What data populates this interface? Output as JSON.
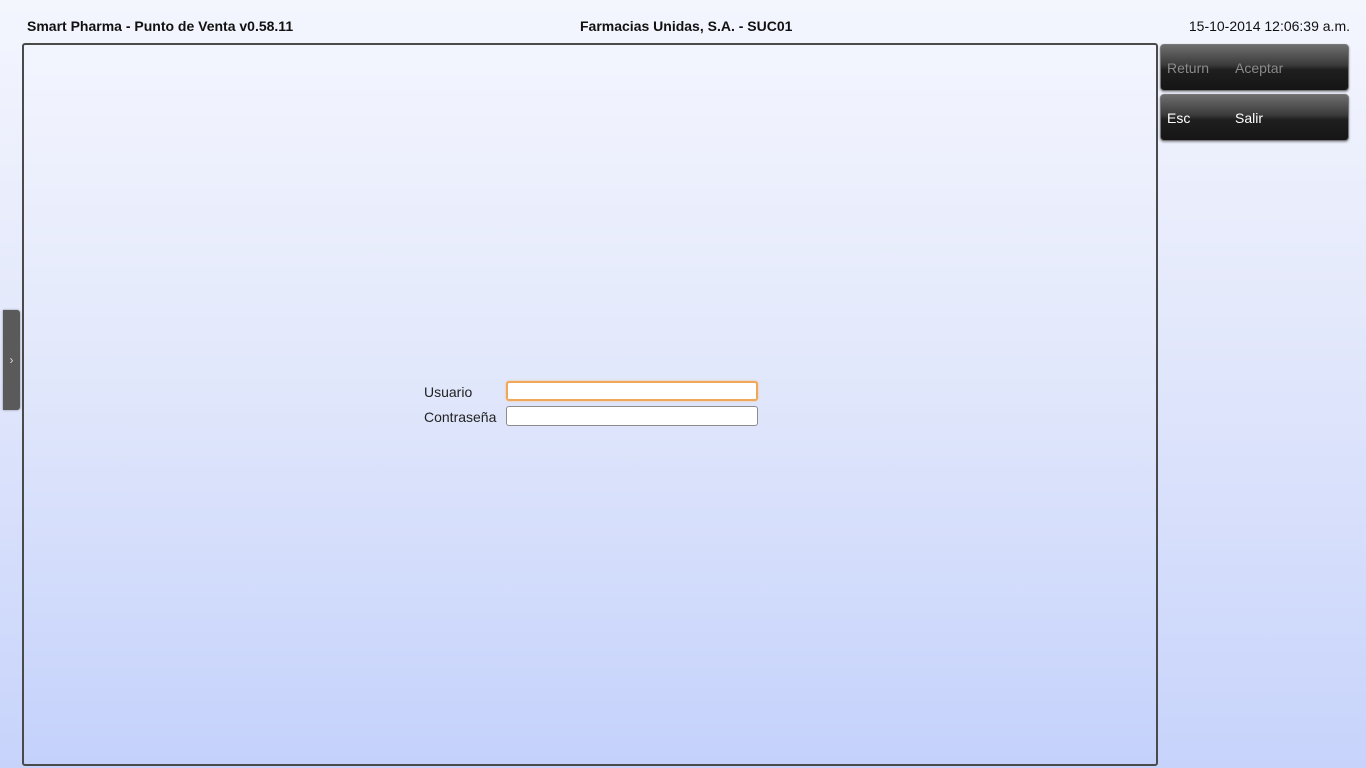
{
  "header": {
    "app_title": "Smart Pharma - Punto de Venta  v0.58.11",
    "company": "Farmacias Unidas, S.A.   -   SUC01",
    "datetime": "15-10-2014 12:06:39 a.m."
  },
  "side_toggle": {
    "glyph": "›",
    "icon": "chevron-right-icon"
  },
  "login": {
    "username_label": "Usuario",
    "username_value": "",
    "password_label": "Contraseña",
    "password_value": ""
  },
  "commands": [
    {
      "key": "Return",
      "label": "Aceptar",
      "enabled": false
    },
    {
      "key": "Esc",
      "label": "Salir",
      "enabled": true
    }
  ],
  "colors": {
    "focus_border": "#f2a65a",
    "button_dark": "#1f1f1f",
    "panel_border": "#4a4a4a"
  }
}
